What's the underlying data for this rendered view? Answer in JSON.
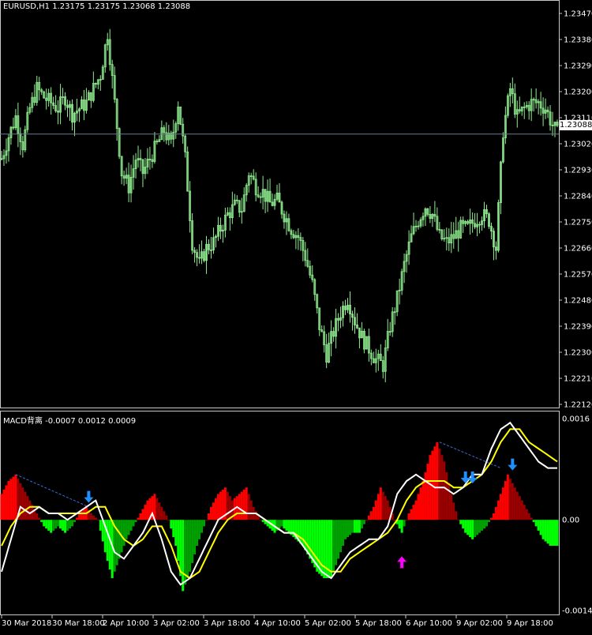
{
  "window": {
    "symbol_header": "EURUSD,H1  1.23175 1.23175 1.23068 1.23088",
    "macd_header": "MACD背离 -0.0007 0.0012 0.0009",
    "current_price": "1.23088"
  },
  "colors": {
    "background": "#000000",
    "candles": "#90ee90",
    "price_line": "#6b7b94",
    "hist_pos_bright": "#ff0000",
    "hist_pos_dark": "#9b0000",
    "hist_neg_bright": "#00ff00",
    "hist_neg_dark": "#00a000",
    "macd_line": "#ffffff",
    "signal_line": "#ffff00",
    "divergence_line": "#3b6fd8",
    "arrow_down": "#1e90ff",
    "arrow_up": "#ff00ff"
  },
  "price_axis_labels": [
    "1.23470",
    "1.23380",
    "1.23290",
    "1.23200",
    "1.23110",
    "1.23020",
    "1.22930",
    "1.22840",
    "1.22750",
    "1.22660",
    "1.22570",
    "1.22480",
    "1.22390",
    "1.22300",
    "1.22210",
    "1.22120"
  ],
  "macd_axis_labels": [
    "0.0016",
    "0.00",
    "-0.0014"
  ],
  "time_axis_labels": [
    "30 Mar 2018",
    "30 Mar 18:00",
    "2 Apr 10:00",
    "3 Apr 02:00",
    "3 Apr 18:00",
    "4 Apr 10:00",
    "5 Apr 02:00",
    "5 Apr 18:00",
    "6 Apr 10:00",
    "9 Apr 02:00",
    "9 Apr 18:00"
  ],
  "chart_data": [
    {
      "type": "candlestick",
      "title": "EURUSD,H1",
      "ylim": [
        1.2212,
        1.2352
      ],
      "x_ticks": [
        "30 Mar 2018",
        "30 Mar 18:00",
        "2 Apr 10:00",
        "3 Apr 02:00",
        "3 Apr 18:00",
        "4 Apr 10:00",
        "5 Apr 02:00",
        "5 Apr 18:00",
        "6 Apr 10:00",
        "9 Apr 02:00",
        "9 Apr 18:00"
      ],
      "close_path": [
        [
          0,
          1.23
        ],
        [
          3,
          1.2308
        ],
        [
          6,
          1.2315
        ],
        [
          9,
          1.2305
        ],
        [
          12,
          1.2318
        ],
        [
          15,
          1.2325
        ],
        [
          18,
          1.2322
        ],
        [
          21,
          1.232
        ],
        [
          24,
          1.2318
        ],
        [
          27,
          1.2322
        ],
        [
          30,
          1.2316
        ],
        [
          33,
          1.2318
        ],
        [
          36,
          1.232
        ],
        [
          39,
          1.2325
        ],
        [
          42,
          1.233
        ],
        [
          45,
          1.2345
        ],
        [
          48,
          1.232
        ],
        [
          51,
          1.2295
        ],
        [
          54,
          1.229
        ],
        [
          57,
          1.23
        ],
        [
          60,
          1.2295
        ],
        [
          63,
          1.23
        ],
        [
          66,
          1.2305
        ],
        [
          69,
          1.231
        ],
        [
          72,
          1.2305
        ],
        [
          75,
          1.232
        ],
        [
          78,
          1.23
        ],
        [
          81,
          1.227
        ],
        [
          84,
          1.2262
        ],
        [
          87,
          1.2268
        ],
        [
          90,
          1.227
        ],
        [
          93,
          1.2275
        ],
        [
          96,
          1.228
        ],
        [
          99,
          1.2283
        ],
        [
          102,
          1.2282
        ],
        [
          105,
          1.2295
        ],
        [
          108,
          1.229
        ],
        [
          111,
          1.2288
        ],
        [
          114,
          1.2284
        ],
        [
          117,
          1.2285
        ],
        [
          120,
          1.228
        ],
        [
          123,
          1.2275
        ],
        [
          126,
          1.2272
        ],
        [
          129,
          1.2265
        ],
        [
          132,
          1.2255
        ],
        [
          135,
          1.224
        ],
        [
          138,
          1.223
        ],
        [
          141,
          1.2238
        ],
        [
          144,
          1.2245
        ],
        [
          147,
          1.225
        ],
        [
          150,
          1.2242
        ],
        [
          153,
          1.2236
        ],
        [
          156,
          1.2232
        ],
        [
          159,
          1.2228
        ],
        [
          162,
          1.2226
        ],
        [
          165,
          1.224
        ],
        [
          168,
          1.225
        ],
        [
          171,
          1.2262
        ],
        [
          174,
          1.2272
        ],
        [
          177,
          1.2278
        ],
        [
          180,
          1.2283
        ],
        [
          183,
          1.228
        ],
        [
          186,
          1.2272
        ],
        [
          189,
          1.227
        ],
        [
          192,
          1.2272
        ],
        [
          195,
          1.2275
        ],
        [
          198,
          1.2275
        ],
        [
          201,
          1.2278
        ],
        [
          204,
          1.228
        ],
        [
          207,
          1.2278
        ],
        [
          210,
          1.2268
        ],
        [
          213,
          1.231
        ],
        [
          216,
          1.2325
        ],
        [
          219,
          1.2315
        ],
        [
          222,
          1.2318
        ],
        [
          225,
          1.232
        ],
        [
          228,
          1.232
        ],
        [
          231,
          1.2318
        ],
        [
          234,
          1.2312
        ],
        [
          236,
          1.2309
        ]
      ],
      "current_price": 1.23088
    },
    {
      "type": "bar+line",
      "title": "MACD背离",
      "values_shown": [
        -0.0007,
        0.0012,
        0.0009
      ],
      "ylim": [
        -0.0014,
        0.0016
      ],
      "zero_line": 0.0,
      "histogram_path": [
        [
          0,
          0.0004
        ],
        [
          3,
          0.0006
        ],
        [
          6,
          0.0007
        ],
        [
          9,
          0.0005
        ],
        [
          12,
          0.0003
        ],
        [
          15,
          0.0001
        ],
        [
          18,
          -0.0001
        ],
        [
          21,
          -0.0002
        ],
        [
          24,
          -0.0001
        ],
        [
          27,
          -0.0002
        ],
        [
          30,
          -0.0001
        ],
        [
          33,
          0.0001
        ],
        [
          36,
          0.0002
        ],
        [
          38,
          0.0001
        ],
        [
          41,
          0.0
        ],
        [
          44,
          -0.0005
        ],
        [
          47,
          -0.0009
        ],
        [
          50,
          -0.0006
        ],
        [
          53,
          -0.0003
        ],
        [
          56,
          -0.0001
        ],
        [
          59,
          0.0001
        ],
        [
          62,
          0.0003
        ],
        [
          65,
          0.0004
        ],
        [
          68,
          0.0002
        ],
        [
          71,
          0.0
        ],
        [
          74,
          -0.0004
        ],
        [
          77,
          -0.0011
        ],
        [
          80,
          -0.0008
        ],
        [
          83,
          -0.0004
        ],
        [
          86,
          -0.0001
        ],
        [
          89,
          0.0002
        ],
        [
          92,
          0.0004
        ],
        [
          95,
          0.0005
        ],
        [
          98,
          0.0003
        ],
        [
          101,
          0.0004
        ],
        [
          104,
          0.0005
        ],
        [
          107,
          0.0002
        ],
        [
          110,
          0.0
        ],
        [
          113,
          -0.0001
        ],
        [
          116,
          -0.0002
        ],
        [
          119,
          -0.0001
        ],
        [
          122,
          -0.0002
        ],
        [
          125,
          -0.0003
        ],
        [
          128,
          -0.0004
        ],
        [
          131,
          -0.0006
        ],
        [
          134,
          -0.0008
        ],
        [
          137,
          -0.0009
        ],
        [
          140,
          -0.0009
        ],
        [
          143,
          -0.0006
        ],
        [
          146,
          -0.0003
        ],
        [
          149,
          -0.0002
        ],
        [
          152,
          -0.0002
        ],
        [
          155,
          0.0
        ],
        [
          158,
          0.0002
        ],
        [
          161,
          0.0005
        ],
        [
          164,
          0.0003
        ],
        [
          167,
          0.0
        ],
        [
          170,
          -0.0002
        ],
        [
          173,
          0.0001
        ],
        [
          176,
          0.0003
        ],
        [
          179,
          0.0006
        ],
        [
          182,
          0.001
        ],
        [
          185,
          0.0012
        ],
        [
          188,
          0.0009
        ],
        [
          191,
          0.0004
        ],
        [
          194,
          0.0
        ],
        [
          197,
          -0.0002
        ],
        [
          200,
          -0.0003
        ],
        [
          203,
          -0.0002
        ],
        [
          206,
          -0.0001
        ],
        [
          209,
          0.0001
        ],
        [
          212,
          0.0004
        ],
        [
          215,
          0.0007
        ],
        [
          218,
          0.0005
        ],
        [
          221,
          0.0003
        ],
        [
          224,
          0.0001
        ],
        [
          227,
          -0.0001
        ],
        [
          230,
          -0.0003
        ],
        [
          233,
          -0.0004
        ],
        [
          236,
          -0.0004
        ]
      ],
      "series": [
        {
          "name": "MACD",
          "values_path": [
            [
              0,
              -0.0008
            ],
            [
              4,
              -0.0003
            ],
            [
              8,
              0.0002
            ],
            [
              12,
              0.0001
            ],
            [
              16,
              0.0002
            ],
            [
              20,
              0.0001
            ],
            [
              24,
              0.0001
            ],
            [
              28,
              0.0
            ],
            [
              32,
              0.0001
            ],
            [
              36,
              0.0002
            ],
            [
              40,
              0.0003
            ],
            [
              44,
              -0.0001
            ],
            [
              48,
              -0.0005
            ],
            [
              52,
              -0.0006
            ],
            [
              56,
              -0.0004
            ],
            [
              60,
              -0.0002
            ],
            [
              64,
              0.0001
            ],
            [
              68,
              -0.0003
            ],
            [
              72,
              -0.0008
            ],
            [
              76,
              -0.001
            ],
            [
              80,
              -0.0009
            ],
            [
              84,
              -0.0006
            ],
            [
              88,
              -0.0003
            ],
            [
              92,
              0.0
            ],
            [
              96,
              0.0001
            ],
            [
              100,
              0.0002
            ],
            [
              104,
              0.0001
            ],
            [
              108,
              0.0001
            ],
            [
              112,
              0.0
            ],
            [
              116,
              -0.0001
            ],
            [
              120,
              -0.0002
            ],
            [
              124,
              -0.0002
            ],
            [
              128,
              -0.0004
            ],
            [
              132,
              -0.0006
            ],
            [
              136,
              -0.0008
            ],
            [
              140,
              -0.0009
            ],
            [
              144,
              -0.0007
            ],
            [
              148,
              -0.0005
            ],
            [
              152,
              -0.0004
            ],
            [
              156,
              -0.0003
            ],
            [
              160,
              -0.0003
            ],
            [
              164,
              -0.0001
            ],
            [
              168,
              0.0004
            ],
            [
              172,
              0.0006
            ],
            [
              176,
              0.0007
            ],
            [
              180,
              0.0006
            ],
            [
              184,
              0.0005
            ],
            [
              188,
              0.0005
            ],
            [
              192,
              0.0004
            ],
            [
              196,
              0.0005
            ],
            [
              200,
              0.0007
            ],
            [
              204,
              0.0007
            ],
            [
              208,
              0.0011
            ],
            [
              212,
              0.0014
            ],
            [
              216,
              0.0015
            ],
            [
              220,
              0.0013
            ],
            [
              224,
              0.0011
            ],
            [
              228,
              0.0009
            ],
            [
              232,
              0.0008
            ],
            [
              236,
              0.0008
            ]
          ]
        },
        {
          "name": "Signal",
          "values_path": [
            [
              0,
              -0.0004
            ],
            [
              4,
              -0.0001
            ],
            [
              8,
              0.0001
            ],
            [
              12,
              0.0002
            ],
            [
              16,
              0.0002
            ],
            [
              20,
              0.0001
            ],
            [
              24,
              0.0001
            ],
            [
              28,
              0.0001
            ],
            [
              32,
              0.0001
            ],
            [
              36,
              0.0001
            ],
            [
              40,
              0.0002
            ],
            [
              44,
              0.0002
            ],
            [
              48,
              -0.0001
            ],
            [
              52,
              -0.0003
            ],
            [
              56,
              -0.0004
            ],
            [
              60,
              -0.0003
            ],
            [
              64,
              -0.0001
            ],
            [
              68,
              -0.0001
            ],
            [
              72,
              -0.0004
            ],
            [
              76,
              -0.0008
            ],
            [
              80,
              -0.0009
            ],
            [
              84,
              -0.0008
            ],
            [
              88,
              -0.0005
            ],
            [
              92,
              -0.0002
            ],
            [
              96,
              0.0
            ],
            [
              100,
              0.0001
            ],
            [
              104,
              0.0001
            ],
            [
              108,
              0.0001
            ],
            [
              112,
              0.0
            ],
            [
              116,
              -0.0001
            ],
            [
              120,
              -0.0002
            ],
            [
              124,
              -0.0002
            ],
            [
              128,
              -0.0003
            ],
            [
              132,
              -0.0005
            ],
            [
              136,
              -0.0007
            ],
            [
              140,
              -0.0008
            ],
            [
              144,
              -0.0008
            ],
            [
              148,
              -0.0006
            ],
            [
              152,
              -0.0005
            ],
            [
              156,
              -0.0004
            ],
            [
              160,
              -0.0003
            ],
            [
              164,
              -0.0002
            ],
            [
              168,
              0.0
            ],
            [
              172,
              0.0003
            ],
            [
              176,
              0.0005
            ],
            [
              180,
              0.0006
            ],
            [
              184,
              0.0006
            ],
            [
              188,
              0.0006
            ],
            [
              192,
              0.0005
            ],
            [
              196,
              0.0005
            ],
            [
              200,
              0.0006
            ],
            [
              204,
              0.0007
            ],
            [
              208,
              0.0009
            ],
            [
              212,
              0.0012
            ],
            [
              216,
              0.0014
            ],
            [
              220,
              0.0014
            ],
            [
              224,
              0.0012
            ],
            [
              228,
              0.0011
            ],
            [
              232,
              0.001
            ],
            [
              236,
              0.0009
            ]
          ]
        }
      ],
      "divergence_lines": [
        {
          "from": [
            6,
            0.0007
          ],
          "to": [
            37,
            0.0002
          ]
        },
        {
          "from": [
            186,
            0.0012
          ],
          "to": [
            212,
            0.0008
          ]
        }
      ],
      "arrows": [
        {
          "dir": "down",
          "at": [
            37,
            0.0003
          ]
        },
        {
          "dir": "down",
          "at": [
            197,
            0.0006
          ]
        },
        {
          "dir": "down",
          "at": [
            200,
            0.0006
          ]
        },
        {
          "dir": "down",
          "at": [
            217,
            0.0008
          ]
        },
        {
          "dir": "up",
          "at": [
            170,
            -0.0006
          ]
        }
      ]
    }
  ]
}
